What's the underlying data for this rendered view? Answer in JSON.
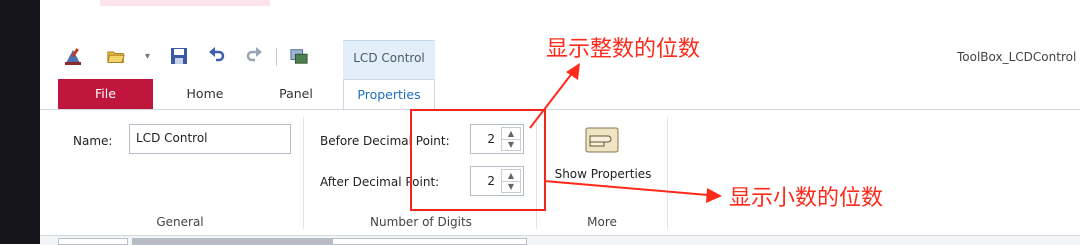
{
  "header": {
    "app_title": "ToolBox_LCDControl",
    "context_tab": "LCD Control"
  },
  "tabs": [
    {
      "label": "File"
    },
    {
      "label": "Home"
    },
    {
      "label": "Panel"
    },
    {
      "label": "Properties"
    }
  ],
  "groups": {
    "general": {
      "label": "General",
      "name_label": "Name:",
      "name_value": "LCD Control"
    },
    "digits": {
      "label": "Number of Digits",
      "before_label": "Before Decimal Point:",
      "before_value": "2",
      "after_label": "After Decimal Point:",
      "after_value": "2"
    },
    "more": {
      "label": "More",
      "show_props_label": "Show Properties"
    }
  },
  "annotations": {
    "integer_digits": "显示整数的位数",
    "decimal_digits": "显示小数的位数"
  },
  "colors": {
    "file_tab": "#c0163e",
    "context_tab": "#e2eef9",
    "properties_tab_text": "#1f6fbf",
    "annotation": "#ff2a1a"
  }
}
